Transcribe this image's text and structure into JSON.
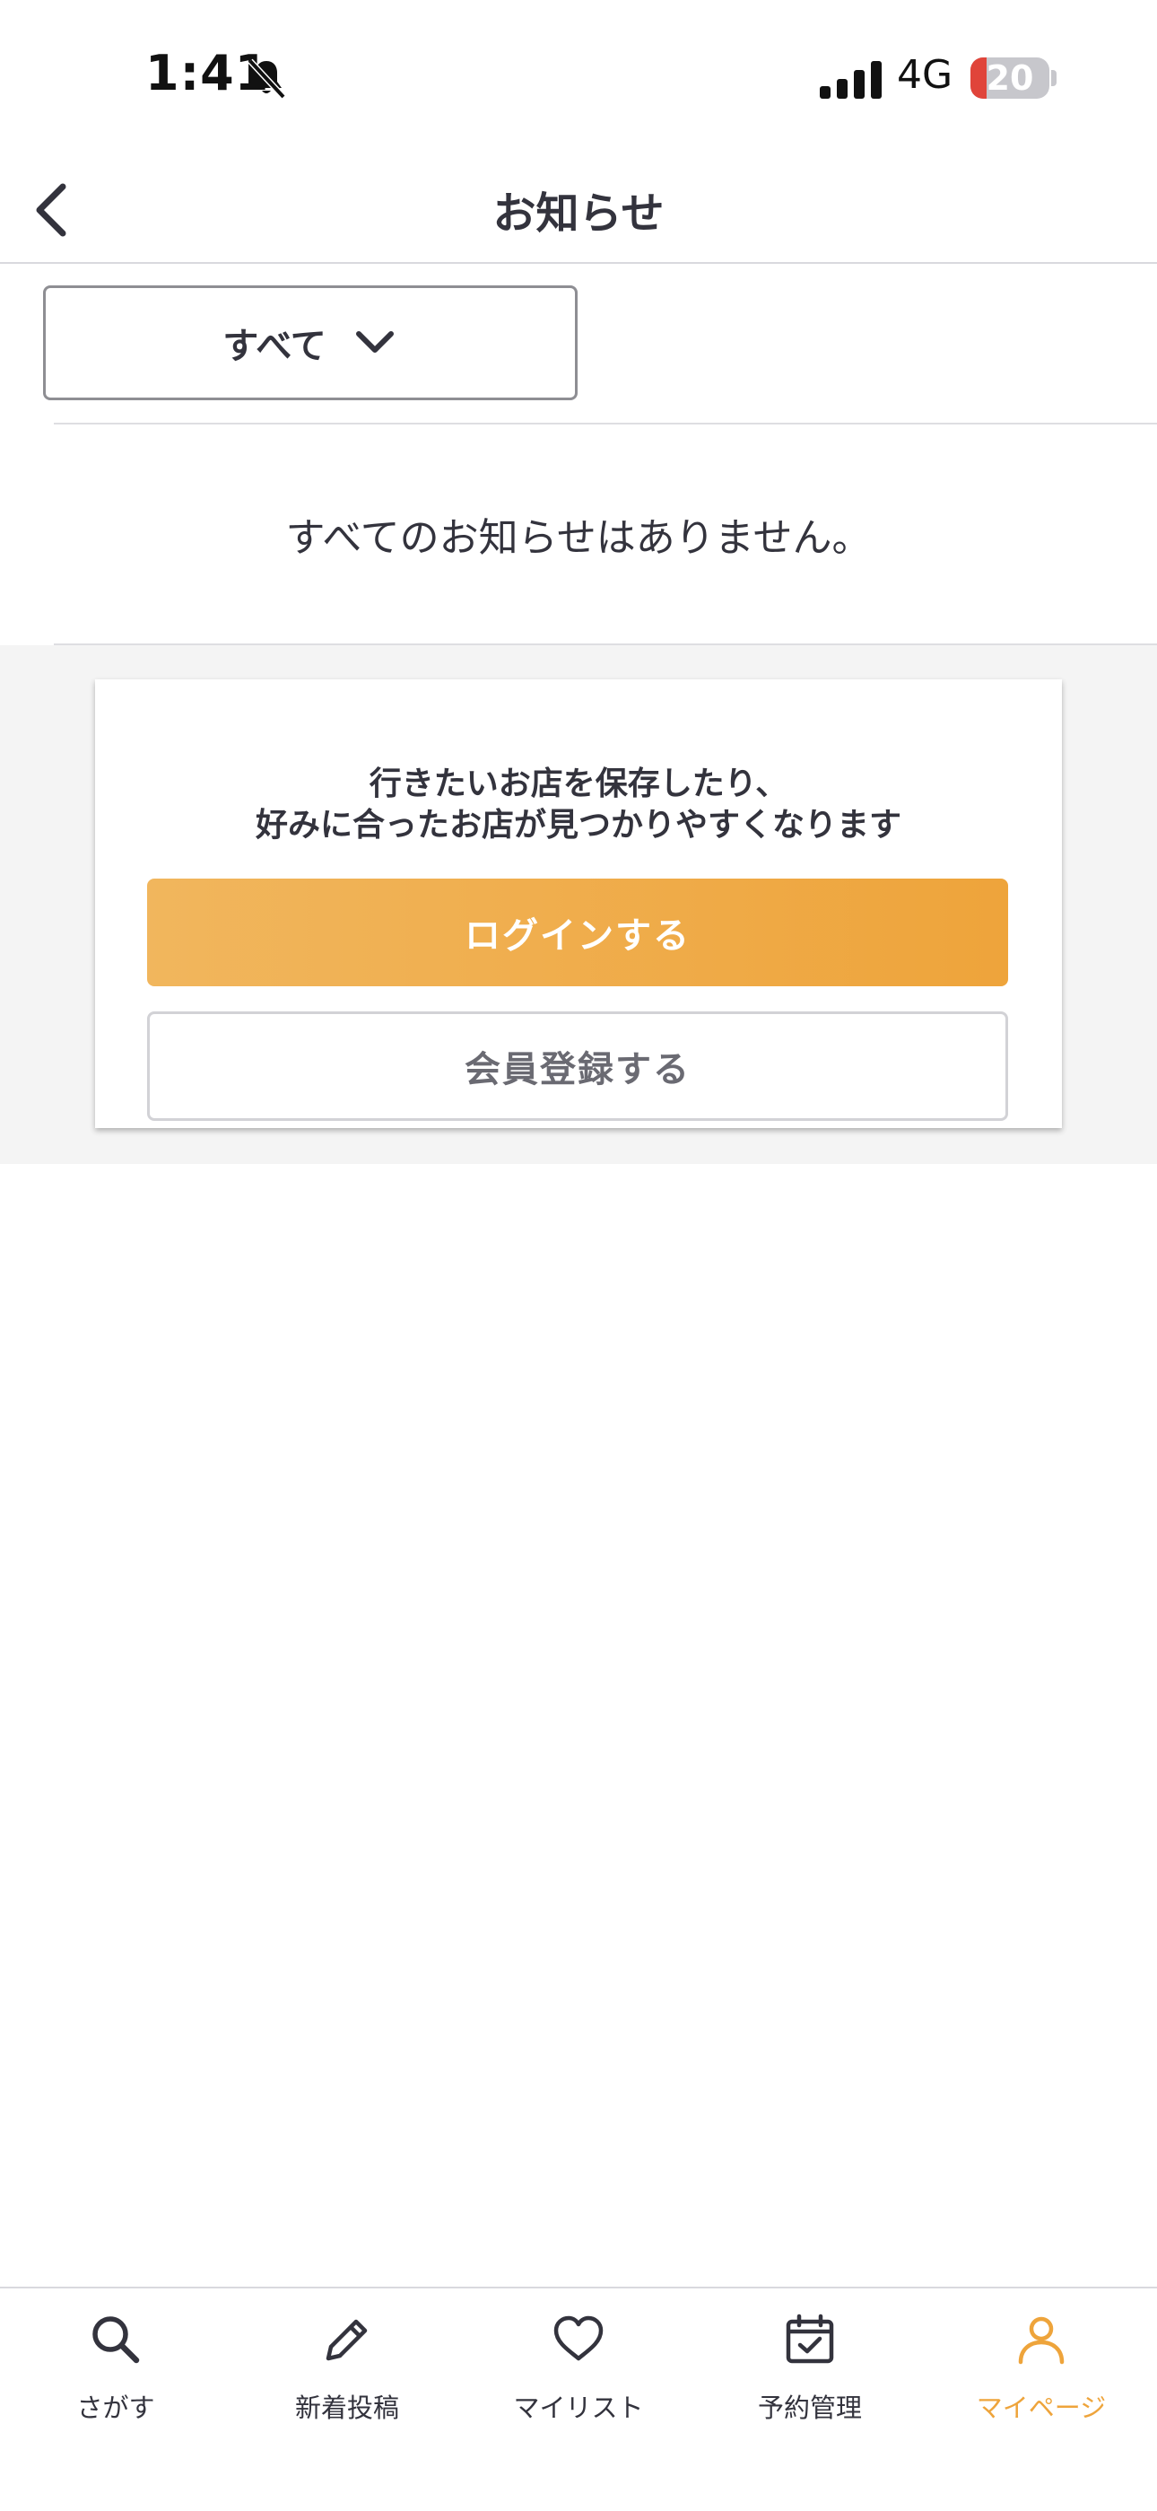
{
  "status_bar": {
    "time": "1:41",
    "network": "4G",
    "battery_level": "20",
    "battery_fraction": 0.2,
    "icons": [
      "bell-slash-icon",
      "signal-icon"
    ]
  },
  "header": {
    "title": "お知らせ",
    "back_icon": "chevron-left-icon"
  },
  "filter": {
    "selected": "すべて",
    "icon": "chevron-down-icon"
  },
  "empty_message": "すべてのお知らせはありません。",
  "promo": {
    "line1": "行きたいお店を保存したり、",
    "line2": "好みに合ったお店が見つかりやすくなります",
    "login_label": "ログインする",
    "register_label": "会員登録する",
    "accent_color": "#eea43b"
  },
  "tab_bar": {
    "active_index": 4,
    "items": [
      {
        "label": "さがす",
        "icon": "search-icon"
      },
      {
        "label": "新着投稿",
        "icon": "pencil-icon"
      },
      {
        "label": "マイリスト",
        "icon": "heart-icon"
      },
      {
        "label": "予約管理",
        "icon": "calendar-check-icon"
      },
      {
        "label": "マイページ",
        "icon": "person-icon"
      }
    ]
  }
}
